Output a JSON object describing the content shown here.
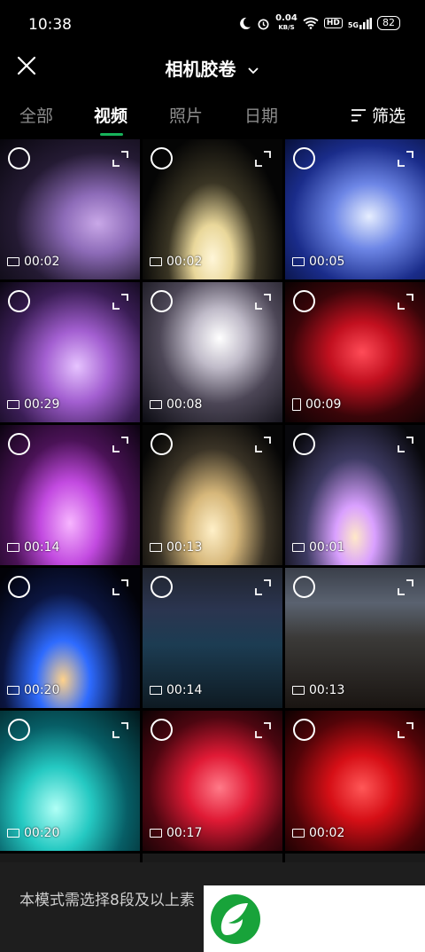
{
  "status_bar": {
    "time": "10:38",
    "net_speed": "0.04",
    "net_unit": "KB/S",
    "hd": "HD",
    "signal": "5G",
    "battery": "82"
  },
  "header": {
    "title": "相机胶卷"
  },
  "tabs": [
    {
      "label": "全部"
    },
    {
      "label": "视频"
    },
    {
      "label": "照片"
    },
    {
      "label": "日期"
    }
  ],
  "filter_label": "筛选",
  "videos": [
    {
      "duration": "00:02"
    },
    {
      "duration": "00:02"
    },
    {
      "duration": "00:05"
    },
    {
      "duration": "00:29"
    },
    {
      "duration": "00:08"
    },
    {
      "duration": "00:09"
    },
    {
      "duration": "00:14"
    },
    {
      "duration": "00:13"
    },
    {
      "duration": "00:01"
    },
    {
      "duration": "00:20"
    },
    {
      "duration": "00:14"
    },
    {
      "duration": "00:13"
    },
    {
      "duration": "00:20"
    },
    {
      "duration": "00:17"
    },
    {
      "duration": "00:02"
    }
  ],
  "bottom": {
    "hint": "本模式需选择8段及以上素"
  },
  "colors": {
    "accent": "#17b35b",
    "logo_green": "#18a33a"
  }
}
